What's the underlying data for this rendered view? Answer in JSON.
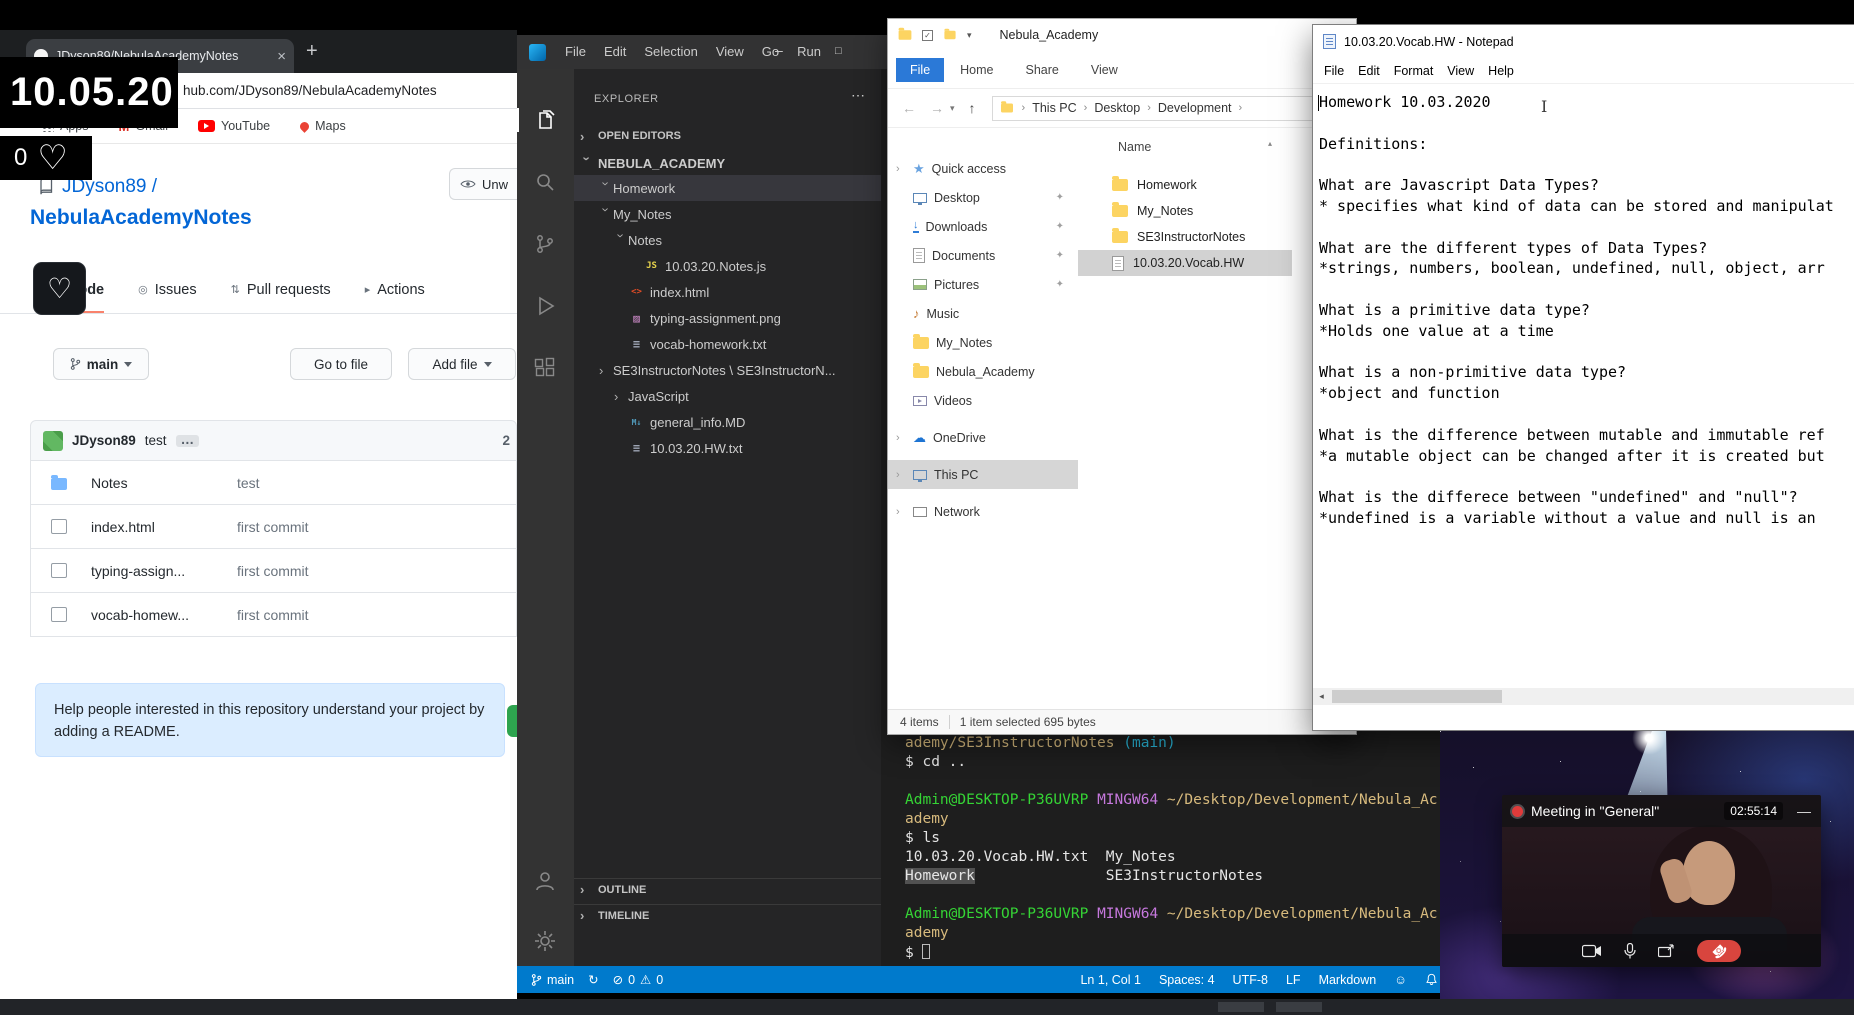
{
  "colors": {
    "statusbar": "#007acc",
    "github_accent": "#f9826c",
    "record_red": "#e03b3b",
    "hangup_red": "#d8453e"
  },
  "overlays": {
    "date": "10.05.20",
    "like_count": "0"
  },
  "browser": {
    "tab_title": "JDyson89/NebulaAcademyNotes",
    "url": "hub.com/JDyson89/NebulaAcademyNotes",
    "bookmarks": [
      "Apps",
      "Gmail",
      "YouTube",
      "Maps"
    ],
    "github": {
      "owner": "JDyson89 /",
      "repo_name": "NebulaAcademyNotes",
      "watch_button": "Unw",
      "nav_tabs": [
        {
          "label": "Code",
          "active": true
        },
        {
          "label": "Issues",
          "active": false
        },
        {
          "label": "Pull requests",
          "active": false
        },
        {
          "label": "Actions",
          "active": false
        }
      ],
      "branch_button": "main",
      "goto_file_button": "Go to file",
      "add_file_button": "Add file",
      "commit_author": "JDyson89",
      "commit_message": "test",
      "commit_count": "2",
      "files": [
        {
          "name": "Notes",
          "type": "folder",
          "commit": "test"
        },
        {
          "name": "index.html",
          "type": "file",
          "commit": "first commit"
        },
        {
          "name": "typing-assign...",
          "type": "file",
          "commit": "first commit"
        },
        {
          "name": "vocab-homew...",
          "type": "file",
          "commit": "first commit"
        }
      ],
      "readme_banner": "Help people interested in this repository understand your project by adding a README."
    }
  },
  "vscode": {
    "menu": [
      "File",
      "Edit",
      "Selection",
      "View",
      "Go",
      "Run"
    ],
    "explorer_title": "EXPLORER",
    "sections": {
      "open_editors": "OPEN EDITORS",
      "root": "NEBULA_ACADEMY",
      "outline": "OUTLINE",
      "timeline": "TIMELINE"
    },
    "tree": [
      {
        "label": "Homework",
        "indent": 1,
        "chevron": "down",
        "selected": true
      },
      {
        "label": "My_Notes",
        "indent": 1,
        "chevron": "down"
      },
      {
        "label": "Notes",
        "indent": 2,
        "chevron": "down"
      },
      {
        "label": "10.03.20.Notes.js",
        "indent": 3,
        "icon": "js"
      },
      {
        "label": "index.html",
        "indent": 2,
        "icon": "html"
      },
      {
        "label": "typing-assignment.png",
        "indent": 2,
        "icon": "img"
      },
      {
        "label": "vocab-homework.txt",
        "indent": 2,
        "icon": "txt"
      },
      {
        "label": "SE3InstructorNotes \\ SE3InstructorN...",
        "indent": 1,
        "chevron": "right"
      },
      {
        "label": "JavaScript",
        "indent": 2,
        "chevron": "right"
      },
      {
        "label": "general_info.MD",
        "indent": 2,
        "icon": "md"
      },
      {
        "label": "10.03.20.HW.txt",
        "indent": 2,
        "icon": "txt"
      }
    ],
    "terminal": [
      [
        {
          "text": "ademy/SE3InstructorNotes ",
          "color": "yellow"
        },
        {
          "text": "(main)",
          "color": "cyan"
        }
      ],
      [
        {
          "text": "$ cd ..",
          "color": "white"
        }
      ],
      [],
      [
        {
          "text": "Admin@DESKTOP-P36UVRP ",
          "color": "green"
        },
        {
          "text": "MINGW64 ",
          "color": "magenta"
        },
        {
          "text": "~/Desktop/Development/Nebula_Ac",
          "color": "yellow"
        }
      ],
      [
        {
          "text": "ademy",
          "color": "yellow"
        }
      ],
      [
        {
          "text": "$ ls",
          "color": "white"
        }
      ],
      [
        {
          "text": "10.03.20.Vocab.HW.txt  My_Notes",
          "color": "white"
        }
      ],
      [
        {
          "text": "Homework",
          "color": "white",
          "highlight": true
        },
        {
          "text": "               SE3InstructorNotes",
          "color": "white"
        }
      ],
      [],
      [
        {
          "text": "Admin@DESKTOP-P36UVRP ",
          "color": "green"
        },
        {
          "text": "MINGW64 ",
          "color": "magenta"
        },
        {
          "text": "~/Desktop/Development/Nebula_Ac",
          "color": "yellow"
        }
      ],
      [
        {
          "text": "ademy",
          "color": "yellow"
        }
      ],
      [
        {
          "text": "$ ",
          "color": "white"
        },
        {
          "cursor": true
        }
      ]
    ],
    "status": {
      "branch": "main",
      "errors": "0",
      "warnings": "0",
      "ln_col": "Ln 1, Col 1",
      "spaces": "Spaces: 4",
      "encoding": "UTF-8",
      "eol": "LF",
      "language": "Markdown"
    }
  },
  "file_explorer": {
    "title": "Nebula_Academy",
    "ribbon": [
      "File",
      "Home",
      "Share",
      "View"
    ],
    "breadcrumbs": [
      "This PC",
      "Desktop",
      "Development"
    ],
    "column_header": "Name",
    "sidebar": [
      {
        "label": "Quick access",
        "icon": "star",
        "section": "root"
      },
      {
        "label": "Desktop",
        "icon": "desktop",
        "pinned": true
      },
      {
        "label": "Downloads",
        "icon": "download",
        "pinned": true
      },
      {
        "label": "Documents",
        "icon": "document",
        "pinned": true
      },
      {
        "label": "Pictures",
        "icon": "pictures",
        "pinned": true
      },
      {
        "label": "Music",
        "icon": "music"
      },
      {
        "label": "My_Notes",
        "icon": "folder"
      },
      {
        "label": "Nebula_Academy",
        "icon": "folder"
      },
      {
        "label": "Videos",
        "icon": "videos"
      },
      {
        "label": "OneDrive",
        "icon": "cloud",
        "section": "root"
      },
      {
        "label": "This PC",
        "icon": "pc",
        "section": "root",
        "selected": true
      },
      {
        "label": "Network",
        "icon": "network",
        "section": "root"
      }
    ],
    "items": [
      {
        "name": "Homework",
        "type": "folder"
      },
      {
        "name": "My_Notes",
        "type": "folder"
      },
      {
        "name": "SE3InstructorNotes",
        "type": "folder"
      },
      {
        "name": "10.03.20.Vocab.HW",
        "type": "file",
        "selected": true
      }
    ],
    "status_items": "4 items",
    "status_selection": "1 item selected 695 bytes"
  },
  "notepad": {
    "title": "10.03.20.Vocab.HW - Notepad",
    "menu": [
      "File",
      "Edit",
      "Format",
      "View",
      "Help"
    ],
    "lines": [
      "Homework 10.03.2020",
      "",
      "Definitions:",
      "",
      "What are Javascript Data Types?",
      "* specifies what kind of data can be stored and manipulat",
      "",
      "What are the different types of Data Types?",
      "*strings, numbers, boolean, undefined, null, object, arr",
      "",
      "What is a primitive data type?",
      "*Holds one value at a time",
      "",
      "What is a non-primitive data type?",
      "*object and function",
      "",
      "What is the difference between mutable and immutable ref",
      "*a mutable object can be changed after it is created but",
      "",
      "What is the differece between \"undefined\" and \"null\"?",
      "*undefined is a variable without a value and null is an"
    ]
  },
  "meeting": {
    "title": "Meeting in \"General\"",
    "timestamp": "02:55:14"
  }
}
